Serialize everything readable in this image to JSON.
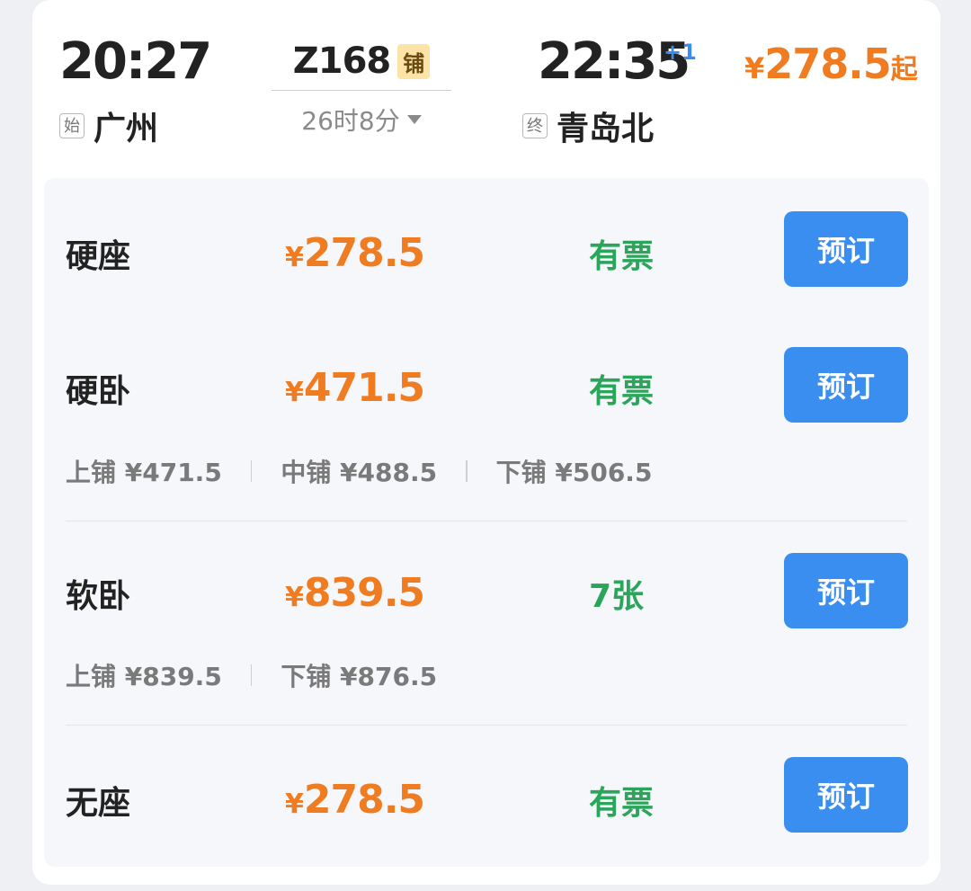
{
  "header": {
    "departure_time": "20:27",
    "departure_tag": "始",
    "departure_station": "广州",
    "train_number": "Z168",
    "berth_badge": "铺",
    "duration": "26时8分",
    "arrival_time": "22:35",
    "day_offset": "+1",
    "arrival_tag": "终",
    "arrival_station": "青岛北",
    "min_price_symbol": "¥",
    "min_price": "278.5",
    "min_price_suffix": "起"
  },
  "seats": [
    {
      "name": "硬座",
      "price_symbol": "¥",
      "price": "278.5",
      "availability": "有票",
      "button": "预订",
      "sub_prices": []
    },
    {
      "name": "硬卧",
      "price_symbol": "¥",
      "price": "471.5",
      "availability": "有票",
      "button": "预订",
      "sub_prices": [
        "上铺 ¥471.5",
        "中铺 ¥488.5",
        "下铺 ¥506.5"
      ]
    },
    {
      "name": "软卧",
      "price_symbol": "¥",
      "price": "839.5",
      "availability": "7张",
      "button": "预订",
      "sub_prices": [
        "上铺 ¥839.5",
        "下铺 ¥876.5"
      ]
    },
    {
      "name": "无座",
      "price_symbol": "¥",
      "price": "278.5",
      "availability": "有票",
      "button": "预订",
      "sub_prices": []
    }
  ],
  "colors": {
    "price": "#f07c22",
    "availability": "#2aa55a",
    "button": "#3a8ef0",
    "day_offset": "#3b8cf0"
  }
}
